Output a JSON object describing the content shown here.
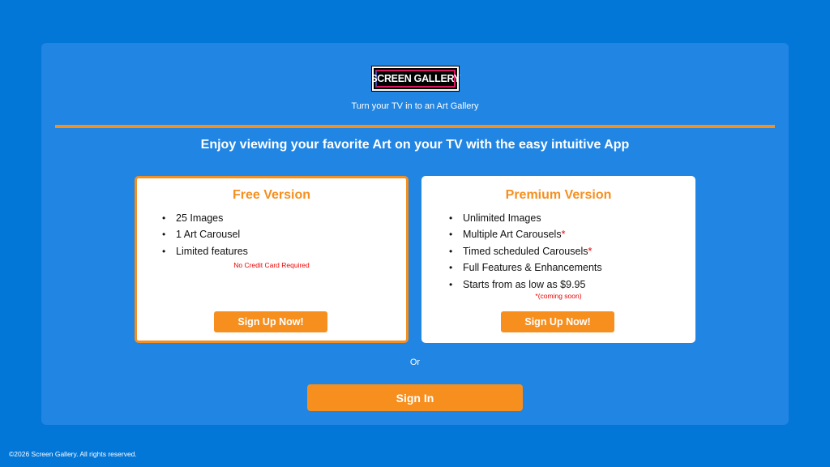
{
  "brand": {
    "logo_text": "SCREEN GALLERY",
    "tagline": "Turn your TV in to an Art Gallery"
  },
  "headline": "Enjoy viewing your favorite Art on your TV with the easy intuitive App",
  "plans": {
    "free": {
      "title": "Free Version",
      "features": [
        "25 Images",
        "1 Art Carousel",
        "Limited features"
      ],
      "note": "No Credit Card Required",
      "cta_label": "Sign Up Now!"
    },
    "premium": {
      "title": "Premium Version",
      "features": [
        "Unlimited Images",
        "Multiple Art Carousels",
        "Timed scheduled Carousels",
        "Full Features & Enhancements",
        "Starts from as low as $9.95"
      ],
      "star_marker": "*",
      "note": "*(coming soon)",
      "cta_label": "Sign Up Now!"
    }
  },
  "or_label": "Or",
  "signin_label": "Sign In",
  "footer": "©2026 Screen Gallery. All rights reserved.",
  "colors": {
    "background": "#0377d8",
    "panel": "#2185e3",
    "accent": "#f68f1e",
    "note": "#ee0000"
  }
}
